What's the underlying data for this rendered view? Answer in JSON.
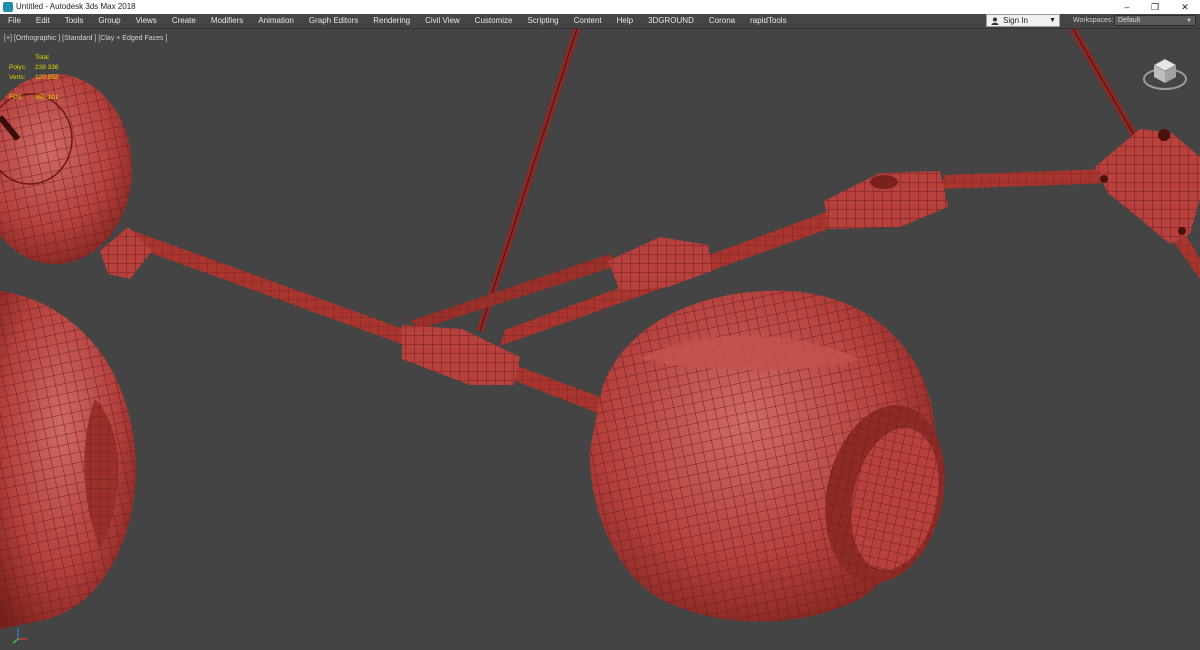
{
  "window": {
    "title": "Untitled - Autodesk 3ds Max 2018",
    "controls": {
      "minimize": "–",
      "maximize": "❐",
      "close": "✕"
    }
  },
  "menu": {
    "items": [
      "File",
      "Edit",
      "Tools",
      "Group",
      "Views",
      "Create",
      "Modifiers",
      "Animation",
      "Graph Editors",
      "Rendering",
      "Civil View",
      "Customize",
      "Scripting",
      "Content",
      "Help",
      "3DGROUND",
      "Corona",
      "rapidTools"
    ]
  },
  "account": {
    "sign_in": "Sign In"
  },
  "workspace": {
    "label": "Workspaces:",
    "value": "Default"
  },
  "viewport": {
    "label": "[+] [Orthographic ] [Standard ] [Clay + Edged Faces ]",
    "stats": {
      "header": "Total",
      "polys_label": "Polys:",
      "polys_value": "238 336",
      "verts_label": "Verts:",
      "verts_value": "120 952",
      "fps_label": "FPS:",
      "fps_value": "995,101"
    }
  },
  "colors": {
    "clay": "#b8413d",
    "wire": "#5a1512",
    "viewport_bg": "#444444",
    "stats_text": "#e2d400"
  }
}
